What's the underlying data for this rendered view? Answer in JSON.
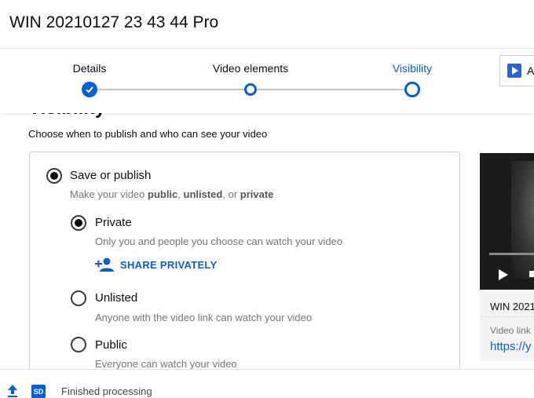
{
  "header": {
    "title": "WIN 20210127 23 43 44 Pro"
  },
  "stepper": {
    "steps": [
      {
        "label": "Details",
        "state": "done"
      },
      {
        "label": "Video elements",
        "state": "pending"
      },
      {
        "label": "Visibility",
        "state": "current"
      }
    ],
    "side_button_label": "A"
  },
  "section": {
    "title": "Visibility",
    "subtitle": "Choose when to publish and who can see your video"
  },
  "save_publish": {
    "label": "Save or publish",
    "desc_prefix": "Make your video ",
    "desc_public": "public",
    "desc_sep1": ", ",
    "desc_unlisted": "unlisted",
    "desc_sep2": ", or ",
    "desc_private": "private",
    "selected": true
  },
  "options": [
    {
      "label": "Private",
      "desc": "Only you and people you choose can watch your video",
      "selected": true
    },
    {
      "label": "Unlisted",
      "desc": "Anyone with the video link can watch your video",
      "selected": false
    },
    {
      "label": "Public",
      "desc": "Everyone can watch your video",
      "selected": false
    }
  ],
  "share_privately": {
    "label": "SHARE PRIVATELY"
  },
  "preview": {
    "title": "WIN 2021",
    "link_label": "Video link",
    "link": "https://y"
  },
  "footer": {
    "badge": "SD",
    "status": "Finished processing"
  },
  "colors": {
    "accent": "#065fd4"
  }
}
